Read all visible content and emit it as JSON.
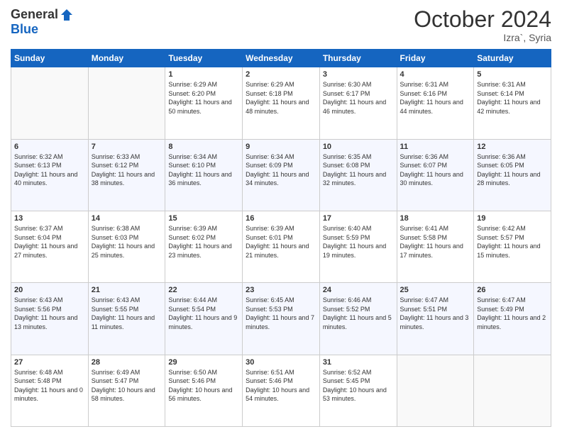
{
  "header": {
    "logo": {
      "general": "General",
      "blue": "Blue"
    },
    "title": "October 2024",
    "location": "Izra`, Syria"
  },
  "days_header": [
    "Sunday",
    "Monday",
    "Tuesday",
    "Wednesday",
    "Thursday",
    "Friday",
    "Saturday"
  ],
  "weeks": [
    [
      {
        "day": "",
        "sunrise": "",
        "sunset": "",
        "daylight": ""
      },
      {
        "day": "",
        "sunrise": "",
        "sunset": "",
        "daylight": ""
      },
      {
        "day": "1",
        "sunrise": "Sunrise: 6:29 AM",
        "sunset": "Sunset: 6:20 PM",
        "daylight": "Daylight: 11 hours and 50 minutes."
      },
      {
        "day": "2",
        "sunrise": "Sunrise: 6:29 AM",
        "sunset": "Sunset: 6:18 PM",
        "daylight": "Daylight: 11 hours and 48 minutes."
      },
      {
        "day": "3",
        "sunrise": "Sunrise: 6:30 AM",
        "sunset": "Sunset: 6:17 PM",
        "daylight": "Daylight: 11 hours and 46 minutes."
      },
      {
        "day": "4",
        "sunrise": "Sunrise: 6:31 AM",
        "sunset": "Sunset: 6:16 PM",
        "daylight": "Daylight: 11 hours and 44 minutes."
      },
      {
        "day": "5",
        "sunrise": "Sunrise: 6:31 AM",
        "sunset": "Sunset: 6:14 PM",
        "daylight": "Daylight: 11 hours and 42 minutes."
      }
    ],
    [
      {
        "day": "6",
        "sunrise": "Sunrise: 6:32 AM",
        "sunset": "Sunset: 6:13 PM",
        "daylight": "Daylight: 11 hours and 40 minutes."
      },
      {
        "day": "7",
        "sunrise": "Sunrise: 6:33 AM",
        "sunset": "Sunset: 6:12 PM",
        "daylight": "Daylight: 11 hours and 38 minutes."
      },
      {
        "day": "8",
        "sunrise": "Sunrise: 6:34 AM",
        "sunset": "Sunset: 6:10 PM",
        "daylight": "Daylight: 11 hours and 36 minutes."
      },
      {
        "day": "9",
        "sunrise": "Sunrise: 6:34 AM",
        "sunset": "Sunset: 6:09 PM",
        "daylight": "Daylight: 11 hours and 34 minutes."
      },
      {
        "day": "10",
        "sunrise": "Sunrise: 6:35 AM",
        "sunset": "Sunset: 6:08 PM",
        "daylight": "Daylight: 11 hours and 32 minutes."
      },
      {
        "day": "11",
        "sunrise": "Sunrise: 6:36 AM",
        "sunset": "Sunset: 6:07 PM",
        "daylight": "Daylight: 11 hours and 30 minutes."
      },
      {
        "day": "12",
        "sunrise": "Sunrise: 6:36 AM",
        "sunset": "Sunset: 6:05 PM",
        "daylight": "Daylight: 11 hours and 28 minutes."
      }
    ],
    [
      {
        "day": "13",
        "sunrise": "Sunrise: 6:37 AM",
        "sunset": "Sunset: 6:04 PM",
        "daylight": "Daylight: 11 hours and 27 minutes."
      },
      {
        "day": "14",
        "sunrise": "Sunrise: 6:38 AM",
        "sunset": "Sunset: 6:03 PM",
        "daylight": "Daylight: 11 hours and 25 minutes."
      },
      {
        "day": "15",
        "sunrise": "Sunrise: 6:39 AM",
        "sunset": "Sunset: 6:02 PM",
        "daylight": "Daylight: 11 hours and 23 minutes."
      },
      {
        "day": "16",
        "sunrise": "Sunrise: 6:39 AM",
        "sunset": "Sunset: 6:01 PM",
        "daylight": "Daylight: 11 hours and 21 minutes."
      },
      {
        "day": "17",
        "sunrise": "Sunrise: 6:40 AM",
        "sunset": "Sunset: 5:59 PM",
        "daylight": "Daylight: 11 hours and 19 minutes."
      },
      {
        "day": "18",
        "sunrise": "Sunrise: 6:41 AM",
        "sunset": "Sunset: 5:58 PM",
        "daylight": "Daylight: 11 hours and 17 minutes."
      },
      {
        "day": "19",
        "sunrise": "Sunrise: 6:42 AM",
        "sunset": "Sunset: 5:57 PM",
        "daylight": "Daylight: 11 hours and 15 minutes."
      }
    ],
    [
      {
        "day": "20",
        "sunrise": "Sunrise: 6:43 AM",
        "sunset": "Sunset: 5:56 PM",
        "daylight": "Daylight: 11 hours and 13 minutes."
      },
      {
        "day": "21",
        "sunrise": "Sunrise: 6:43 AM",
        "sunset": "Sunset: 5:55 PM",
        "daylight": "Daylight: 11 hours and 11 minutes."
      },
      {
        "day": "22",
        "sunrise": "Sunrise: 6:44 AM",
        "sunset": "Sunset: 5:54 PM",
        "daylight": "Daylight: 11 hours and 9 minutes."
      },
      {
        "day": "23",
        "sunrise": "Sunrise: 6:45 AM",
        "sunset": "Sunset: 5:53 PM",
        "daylight": "Daylight: 11 hours and 7 minutes."
      },
      {
        "day": "24",
        "sunrise": "Sunrise: 6:46 AM",
        "sunset": "Sunset: 5:52 PM",
        "daylight": "Daylight: 11 hours and 5 minutes."
      },
      {
        "day": "25",
        "sunrise": "Sunrise: 6:47 AM",
        "sunset": "Sunset: 5:51 PM",
        "daylight": "Daylight: 11 hours and 3 minutes."
      },
      {
        "day": "26",
        "sunrise": "Sunrise: 6:47 AM",
        "sunset": "Sunset: 5:49 PM",
        "daylight": "Daylight: 11 hours and 2 minutes."
      }
    ],
    [
      {
        "day": "27",
        "sunrise": "Sunrise: 6:48 AM",
        "sunset": "Sunset: 5:48 PM",
        "daylight": "Daylight: 11 hours and 0 minutes."
      },
      {
        "day": "28",
        "sunrise": "Sunrise: 6:49 AM",
        "sunset": "Sunset: 5:47 PM",
        "daylight": "Daylight: 10 hours and 58 minutes."
      },
      {
        "day": "29",
        "sunrise": "Sunrise: 6:50 AM",
        "sunset": "Sunset: 5:46 PM",
        "daylight": "Daylight: 10 hours and 56 minutes."
      },
      {
        "day": "30",
        "sunrise": "Sunrise: 6:51 AM",
        "sunset": "Sunset: 5:46 PM",
        "daylight": "Daylight: 10 hours and 54 minutes."
      },
      {
        "day": "31",
        "sunrise": "Sunrise: 6:52 AM",
        "sunset": "Sunset: 5:45 PM",
        "daylight": "Daylight: 10 hours and 53 minutes."
      },
      {
        "day": "",
        "sunrise": "",
        "sunset": "",
        "daylight": ""
      },
      {
        "day": "",
        "sunrise": "",
        "sunset": "",
        "daylight": ""
      }
    ]
  ]
}
